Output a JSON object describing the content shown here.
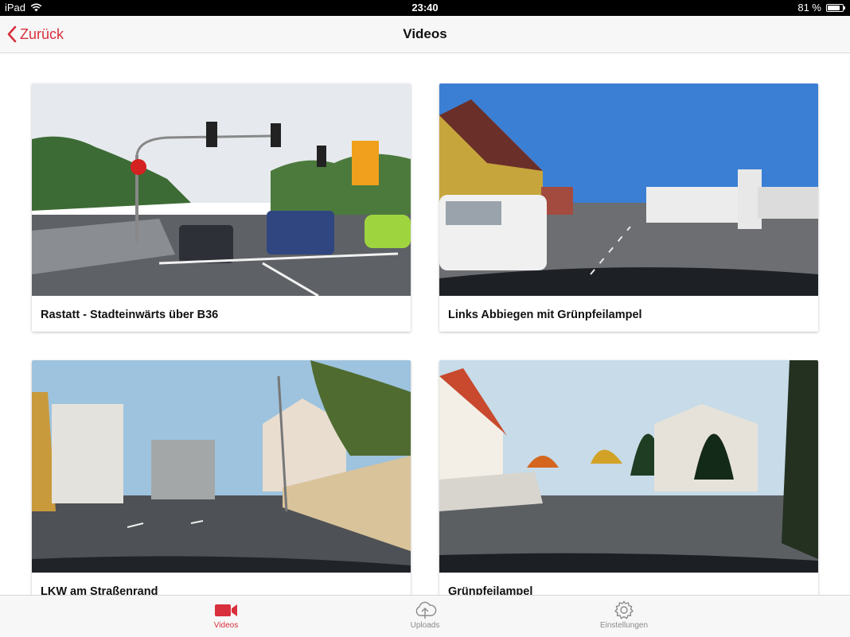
{
  "status_bar": {
    "carrier": "iPad",
    "time": "23:40",
    "battery_percent": "81 %",
    "battery_level": 0.81
  },
  "nav": {
    "back_label": "Zurück",
    "title": "Videos"
  },
  "videos": [
    {
      "title": "Rastatt - Stadteinwärts über B36"
    },
    {
      "title": "Links Abbiegen mit Grünpfeilampel"
    },
    {
      "title": "LKW am Straßenrand"
    },
    {
      "title": "Grünpfeilampel"
    }
  ],
  "tabs": [
    {
      "label": "Videos",
      "icon": "video-camera-icon",
      "active": true
    },
    {
      "label": "Uploads",
      "icon": "cloud-upload-icon",
      "active": false
    },
    {
      "label": "Einstellungen",
      "icon": "gear-icon",
      "active": false
    }
  ],
  "colors": {
    "accent": "#d8303c",
    "inactive_tab": "#8a8a8a",
    "bar_background": "#f7f7f7"
  }
}
